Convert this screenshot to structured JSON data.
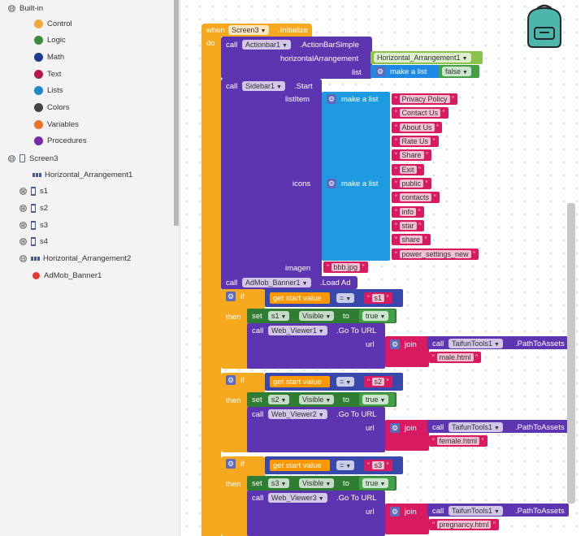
{
  "sidebar": {
    "builtin": {
      "label": "Built-in",
      "toggle": "⊟"
    },
    "categories": [
      {
        "label": "Control",
        "color": "#f2a93b"
      },
      {
        "label": "Logic",
        "color": "#3d8b3d"
      },
      {
        "label": "Math",
        "color": "#1e3a8a"
      },
      {
        "label": "Text",
        "color": "#b5174f"
      },
      {
        "label": "Lists",
        "color": "#1e88c9"
      },
      {
        "label": "Colors",
        "color": "#444444"
      },
      {
        "label": "Variables",
        "color": "#e8742b"
      },
      {
        "label": "Procedures",
        "color": "#7a2aa6"
      }
    ],
    "screen": {
      "label": "Screen3",
      "toggle": "⊟"
    },
    "components": [
      {
        "label": "Horizontal_Arrangement1",
        "toggle": ""
      },
      {
        "label": "s1",
        "toggle": "⊞"
      },
      {
        "label": "s2",
        "toggle": "⊞"
      },
      {
        "label": "s3",
        "toggle": "⊞"
      },
      {
        "label": "s4",
        "toggle": "⊞"
      },
      {
        "label": "Horizontal_Arrangement2",
        "toggle": "⊟"
      },
      {
        "label": "AdMob_Banner1",
        "toggle": ""
      }
    ]
  },
  "blocks": {
    "when": {
      "kw": "when",
      "screen": "Screen3",
      "event": ".Initialize",
      "do": "do"
    },
    "actionbar": {
      "call": "call",
      "comp": "Actionbar1",
      "method": ".ActionBarSimple",
      "arg1": "horizontalArrangement",
      "val1": "Horizontal_Arrangement1",
      "arg2": "list",
      "make": "make a list",
      "val2": "false"
    },
    "sidebarcall": {
      "call": "call",
      "comp": "Sidebar1",
      "method": ".Start",
      "arg1": "listItem",
      "make": "make a list",
      "items": [
        "Privacy Policy",
        "Contact Us",
        "About Us",
        "Rate Us",
        "Share",
        "Exit"
      ],
      "arg2": "icons",
      "icons": [
        "public",
        "contacts",
        "info",
        "star",
        "share",
        "power_settings_new"
      ],
      "arg3": "imagen",
      "img": "bbb.jpg"
    },
    "admob": {
      "call": "call",
      "comp": "AdMob_Banner1",
      "method": ".Load Ad"
    },
    "ifs": [
      {
        "if": "if",
        "then": "then",
        "getstart": "get start value",
        "op": "=",
        "val": "s1",
        "set": "set",
        "comp": "s1",
        "prop": "Visible",
        "to": "to",
        "bool": "true",
        "call": "call",
        "viewer": "Web_Viewer1",
        "method": ".Go To URL",
        "url": "url",
        "join": "join",
        "tools": "TaifunTools1",
        "path": ".PathToAssets",
        "file": "male.html"
      },
      {
        "if": "if",
        "then": "then",
        "getstart": "get start value",
        "op": "=",
        "val": "s2",
        "set": "set",
        "comp": "s2",
        "prop": "Visible",
        "to": "to",
        "bool": "true",
        "call": "call",
        "viewer": "Web_Viewer2",
        "method": ".Go To URL",
        "url": "url",
        "join": "join",
        "tools": "TaifunTools1",
        "path": ".PathToAssets",
        "file": "female.html"
      },
      {
        "if": "if",
        "then": "then",
        "getstart": "get start value",
        "op": "=",
        "val": "s3",
        "set": "set",
        "comp": "s3",
        "prop": "Visible",
        "to": "to",
        "bool": "true",
        "call": "call",
        "viewer": "Web_Viewer3",
        "method": ".Go To URL",
        "url": "url",
        "join": "join",
        "tools": "TaifunTools1",
        "path": ".PathToAssets",
        "file": "pregnancy.html"
      }
    ]
  },
  "backpack": {
    "icon": "backpack-icon"
  }
}
